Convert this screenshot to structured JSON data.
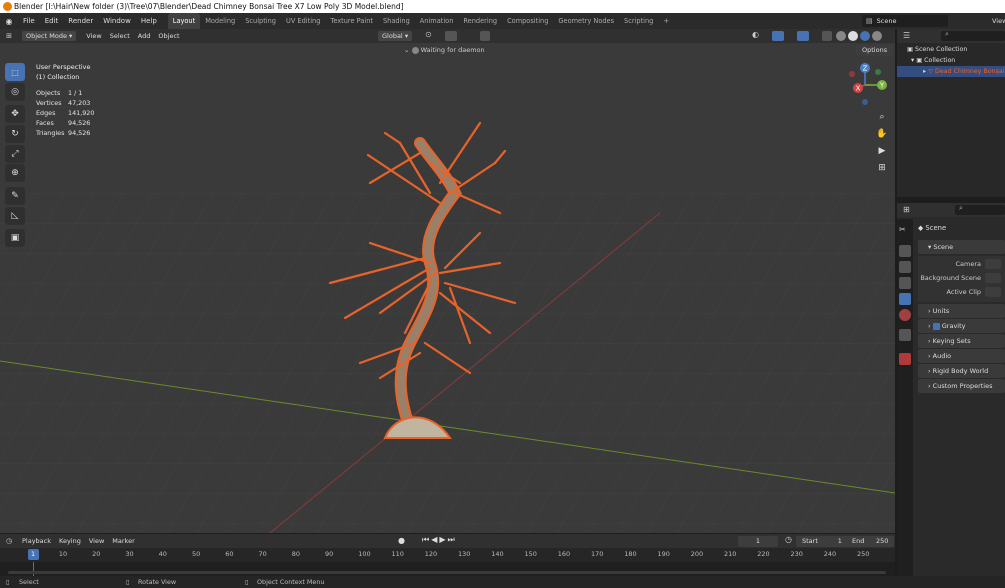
{
  "window": {
    "title": "Blender [I:\\Hair\\New folder (3)\\Tree\\07\\Blender\\Dead Chimney Bonsai Tree X7 Low Poly 3D Model.blend]"
  },
  "menus": [
    "File",
    "Edit",
    "Render",
    "Window",
    "Help"
  ],
  "workspaces": [
    "Layout",
    "Modeling",
    "Sculpting",
    "UV Editing",
    "Texture Paint",
    "Shading",
    "Animation",
    "Rendering",
    "Compositing",
    "Geometry Nodes",
    "Scripting"
  ],
  "active_workspace": "Layout",
  "scene_field": "Scene",
  "view_layer_label": "View",
  "viewport_header": {
    "mode": "Object Mode",
    "menus": [
      "View",
      "Select",
      "Add",
      "Object"
    ],
    "orientation": "Global",
    "options": "Options"
  },
  "daemon_status": "Waiting for daemon",
  "overlay": {
    "perspective": "User Perspective",
    "collection": "(1) Collection"
  },
  "stats": [
    {
      "label": "Objects",
      "value": "1 / 1"
    },
    {
      "label": "Vertices",
      "value": "47,203"
    },
    {
      "label": "Edges",
      "value": "141,920"
    },
    {
      "label": "Faces",
      "value": "94,526"
    },
    {
      "label": "Triangles",
      "value": "94,526"
    }
  ],
  "gizmo": {
    "z": "Z",
    "y": "Y",
    "x": "X"
  },
  "outliner": {
    "root": "Scene Collection",
    "collection": "Collection",
    "object": "Dead Chimney Bonsai"
  },
  "properties": {
    "scene_title": "Scene",
    "panel_scene": "Scene",
    "camera_label": "Camera",
    "background_scene_label": "Background Scene",
    "active_clip_label": "Active Clip",
    "panels": [
      "Units",
      "Gravity",
      "Keying Sets",
      "Audio",
      "Rigid Body World",
      "Custom Properties"
    ],
    "gravity_checked": true
  },
  "timeline": {
    "menus": [
      "Playback",
      "Keying",
      "View",
      "Marker"
    ],
    "current_frame": "1",
    "start_label": "Start",
    "start": "1",
    "end_label": "End",
    "end": "250",
    "ticks": [
      "1",
      "10",
      "20",
      "30",
      "40",
      "50",
      "60",
      "70",
      "80",
      "90",
      "100",
      "110",
      "120",
      "130",
      "140",
      "150",
      "160",
      "170",
      "180",
      "190",
      "200",
      "210",
      "220",
      "230",
      "240",
      "250"
    ]
  },
  "statusbar": {
    "select": "Select",
    "rotate": "Rotate View",
    "context": "Object Context Menu"
  },
  "colors": {
    "accent": "#4772b3",
    "selection": "#e8632a",
    "header_active": "#404040"
  }
}
